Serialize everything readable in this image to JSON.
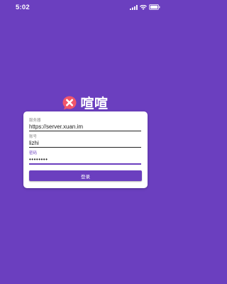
{
  "status_bar": {
    "time": "5:02",
    "icons": [
      "signal-icon",
      "wifi-icon",
      "battery-icon"
    ]
  },
  "brand": {
    "name": "喧喧",
    "logo": "xuanxuan-logo-icon",
    "logo_color": "#f0566b"
  },
  "form": {
    "server": {
      "label": "服务器",
      "value": "https://server.xuan.im"
    },
    "account": {
      "label": "账号",
      "value": "lizhi"
    },
    "password": {
      "label": "密码",
      "masked_value": "••••••••"
    },
    "login_label": "登录"
  },
  "colors": {
    "background": "#6b3fbf",
    "accent": "#6b3fbf",
    "card": "#ffffff"
  }
}
